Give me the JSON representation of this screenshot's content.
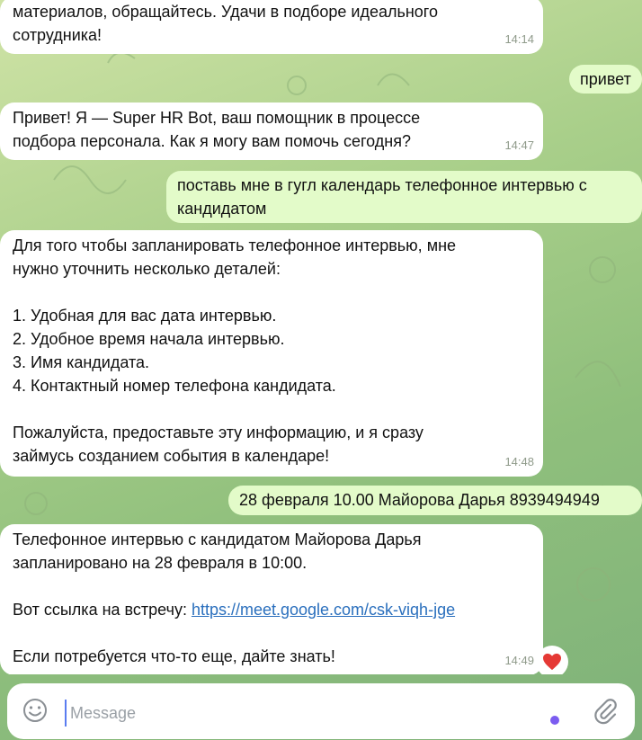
{
  "messages": {
    "m1": {
      "line1": "материалов, обращайтесь. Удачи в подборе идеального",
      "line2": "сотрудника!",
      "time": "14:14"
    },
    "m2": {
      "text": "привет"
    },
    "m3": {
      "line1": "Привет! Я — Super HR Bot, ваш помощник в процессе",
      "line2": "подбора персонала. Как я могу вам помочь сегодня?",
      "time": "14:47"
    },
    "m4": {
      "line1": "поставь мне в гугл календарь телефонное интервью с",
      "line2": "кандидатом"
    },
    "m5": {
      "line1": "Для того чтобы запланировать телефонное интервью, мне",
      "line2": "нужно уточнить несколько деталей:",
      "item1": "1. Удобная для вас дата интервью.",
      "item2": "2. Удобное время начала интервью.",
      "item3": "3. Имя кандидата.",
      "item4": "4. Контактный номер телефона кандидата.",
      "line3": "Пожалуйста, предоставьте эту информацию, и я сразу",
      "line4": "займусь созданием события в календаре!",
      "time": "14:48"
    },
    "m6": {
      "text": "28 февраля 10.00 Майорова Дарья 8939494949"
    },
    "m7": {
      "line1": "Телефонное интервью с кандидатом Майорова Дарья",
      "line2": "запланировано на 28 февраля в 10:00.",
      "link_prefix": "Вот ссылка на встречу: ",
      "link": "https://meet.google.com/csk-viqh-jge",
      "line3": "Если потребуется что-то еще, дайте знать!",
      "time": "14:49",
      "reaction": "red-heart"
    }
  },
  "composer": {
    "placeholder": "Message",
    "emoji_icon": "smile-icon",
    "attach_icon": "paperclip-icon"
  },
  "colors": {
    "incoming": "#ffffff",
    "outgoing": "#e3fbc9",
    "link": "#2a6fbd",
    "heart": "#e53935"
  }
}
